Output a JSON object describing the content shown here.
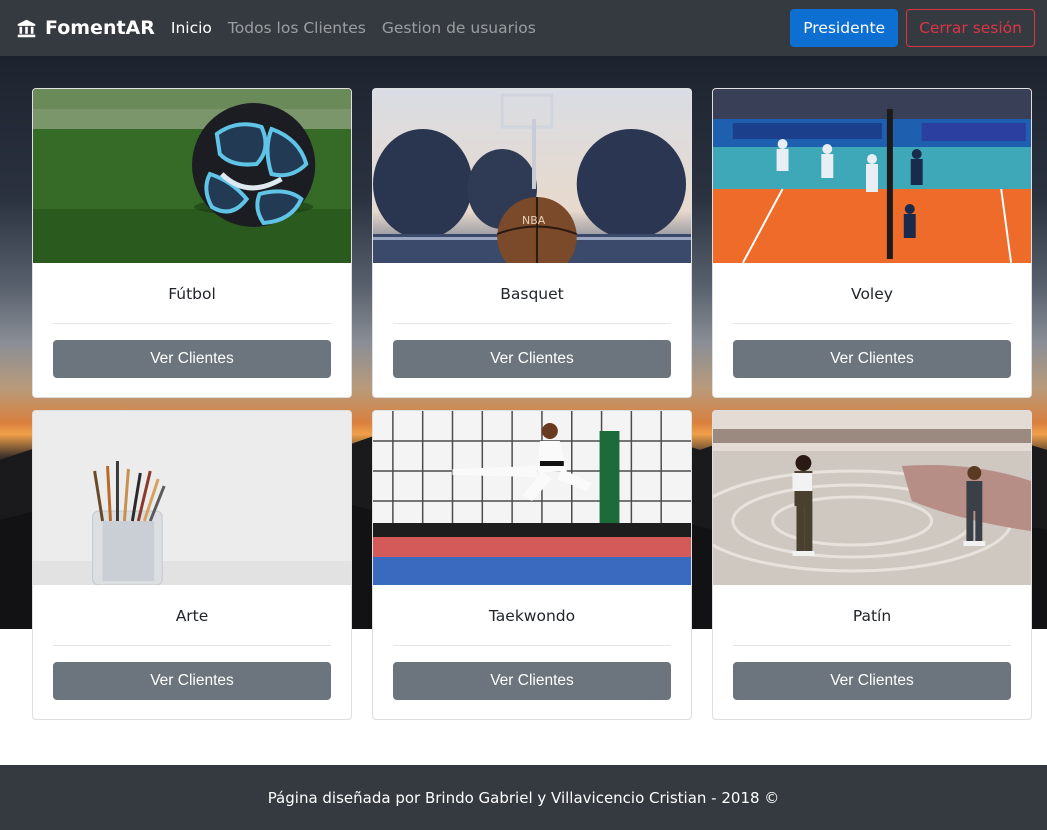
{
  "navbar": {
    "brand": "FomentAR",
    "brand_icon": "institution-icon",
    "links": [
      {
        "label": "Inicio",
        "active": true
      },
      {
        "label": "Todos los Clientes",
        "active": false
      },
      {
        "label": "Gestion de usuarios",
        "active": false
      }
    ],
    "role_button": "Presidente",
    "logout_button": "Cerrar sesión"
  },
  "sports": [
    {
      "name": "Fútbol",
      "button": "Ver Clientes"
    },
    {
      "name": "Basquet",
      "button": "Ver Clientes"
    },
    {
      "name": "Voley",
      "button": "Ver Clientes"
    },
    {
      "name": "Arte",
      "button": "Ver Clientes"
    },
    {
      "name": "Taekwondo",
      "button": "Ver Clientes"
    },
    {
      "name": "Patín",
      "button": "Ver Clientes"
    }
  ],
  "footer": {
    "text": "Página diseñada por Brindo Gabriel y Villavicencio Cristian - 2018 ©"
  },
  "colors": {
    "navbar_bg": "#343a40",
    "primary": "#0d6fd1",
    "danger": "#dc3545",
    "secondary": "#6c757d"
  }
}
